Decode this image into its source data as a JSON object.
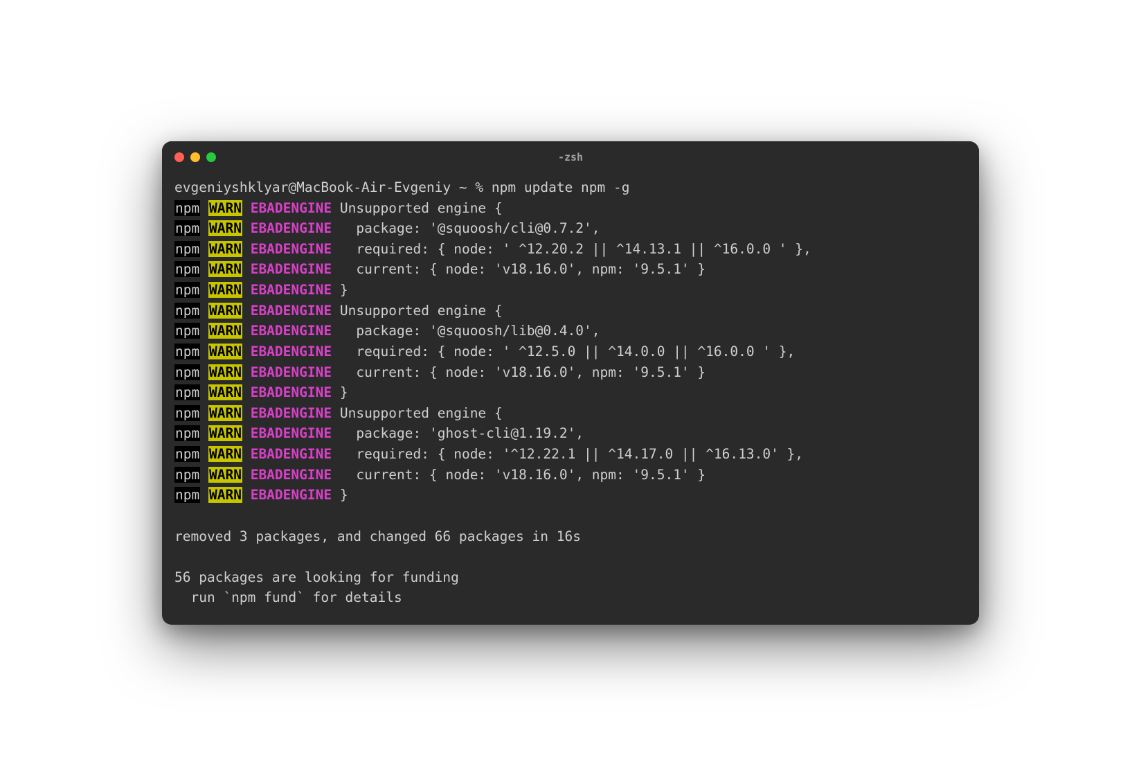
{
  "window": {
    "title": "-zsh"
  },
  "prompt": {
    "user_host": "evgeniyshklyar@MacBook-Air-Evgeniy",
    "cwd": "~",
    "symbol": "%",
    "command": "npm update npm -g"
  },
  "warn_prefix": {
    "npm": "npm",
    "warn": "WARN",
    "code": "EBADENGINE"
  },
  "lines": [
    {
      "msg": " Unsupported engine {"
    },
    {
      "msg": "   package: '@squoosh/cli@0.7.2',"
    },
    {
      "msg": "   required: { node: ' ^12.20.2 || ^14.13.1 || ^16.0.0 ' },"
    },
    {
      "msg": "   current: { node: 'v18.16.0', npm: '9.5.1' }"
    },
    {
      "msg": " }"
    },
    {
      "msg": " Unsupported engine {"
    },
    {
      "msg": "   package: '@squoosh/lib@0.4.0',"
    },
    {
      "msg": "   required: { node: ' ^12.5.0 || ^14.0.0 || ^16.0.0 ' },"
    },
    {
      "msg": "   current: { node: 'v18.16.0', npm: '9.5.1' }"
    },
    {
      "msg": " }"
    },
    {
      "msg": " Unsupported engine {"
    },
    {
      "msg": "   package: 'ghost-cli@1.19.2',"
    },
    {
      "msg": "   required: { node: '^12.22.1 || ^14.17.0 || ^16.13.0' },"
    },
    {
      "msg": "   current: { node: 'v18.16.0', npm: '9.5.1' }"
    },
    {
      "msg": " }"
    }
  ],
  "summary": {
    "l1": "removed 3 packages, and changed 66 packages in 16s",
    "l2": "56 packages are looking for funding",
    "l3": "  run `npm fund` for details"
  }
}
